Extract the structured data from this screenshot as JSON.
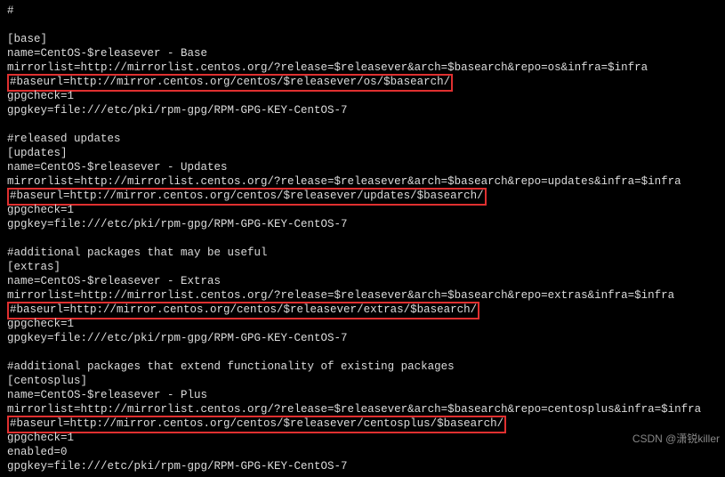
{
  "lines": [
    {
      "text": "#"
    },
    {
      "text": ""
    },
    {
      "text": "[base]"
    },
    {
      "text": "name=CentOS-$releasever - Base"
    },
    {
      "text": "mirrorlist=http://mirrorlist.centos.org/?release=$releasever&arch=$basearch&repo=os&infra=$infra"
    },
    {
      "text": "#baseurl=http://mirror.centos.org/centos/$releasever/os/$basearch/",
      "highlight": true
    },
    {
      "text": "gpgcheck=1"
    },
    {
      "text": "gpgkey=file:///etc/pki/rpm-gpg/RPM-GPG-KEY-CentOS-7"
    },
    {
      "text": ""
    },
    {
      "text": "#released updates"
    },
    {
      "text": "[updates]"
    },
    {
      "text": "name=CentOS-$releasever - Updates"
    },
    {
      "text": "mirrorlist=http://mirrorlist.centos.org/?release=$releasever&arch=$basearch&repo=updates&infra=$infra"
    },
    {
      "text": "#baseurl=http://mirror.centos.org/centos/$releasever/updates/$basearch/",
      "highlight": true
    },
    {
      "text": "gpgcheck=1"
    },
    {
      "text": "gpgkey=file:///etc/pki/rpm-gpg/RPM-GPG-KEY-CentOS-7"
    },
    {
      "text": ""
    },
    {
      "text": "#additional packages that may be useful"
    },
    {
      "text": "[extras]"
    },
    {
      "text": "name=CentOS-$releasever - Extras"
    },
    {
      "text": "mirrorlist=http://mirrorlist.centos.org/?release=$releasever&arch=$basearch&repo=extras&infra=$infra"
    },
    {
      "text": "#baseurl=http://mirror.centos.org/centos/$releasever/extras/$basearch/",
      "highlight": true
    },
    {
      "text": "gpgcheck=1"
    },
    {
      "text": "gpgkey=file:///etc/pki/rpm-gpg/RPM-GPG-KEY-CentOS-7"
    },
    {
      "text": ""
    },
    {
      "text": "#additional packages that extend functionality of existing packages"
    },
    {
      "text": "[centosplus]"
    },
    {
      "text": "name=CentOS-$releasever - Plus"
    },
    {
      "text": "mirrorlist=http://mirrorlist.centos.org/?release=$releasever&arch=$basearch&repo=centosplus&infra=$infra"
    },
    {
      "text": "#baseurl=http://mirror.centos.org/centos/$releasever/centosplus/$basearch/",
      "highlight": true
    },
    {
      "text": "gpgcheck=1"
    },
    {
      "text": "enabled=0"
    },
    {
      "text": "gpgkey=file:///etc/pki/rpm-gpg/RPM-GPG-KEY-CentOS-7"
    }
  ],
  "watermark": "CSDN @潇锐killer"
}
